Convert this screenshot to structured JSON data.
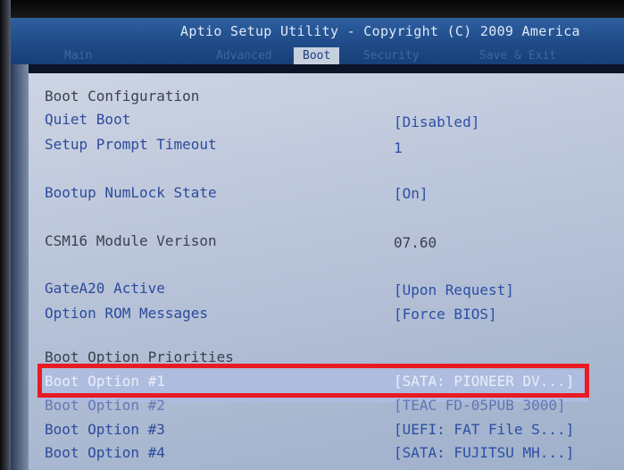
{
  "header": {
    "title": "Aptio Setup Utility - Copyright (C) 2009 America",
    "tabs": {
      "main": "Main",
      "advanced": "Advanced",
      "boot": "Boot",
      "security": "Security",
      "save_exit": "Save & Exit"
    }
  },
  "boot": {
    "section_title": "Boot Configuration",
    "quiet_boot": {
      "label": "Quiet Boot",
      "value": "[Disabled]"
    },
    "setup_prompt_timeout": {
      "label": "Setup Prompt Timeout",
      "value": "1"
    },
    "numlock": {
      "label": "Bootup NumLock State",
      "value": "[On]"
    },
    "csm16": {
      "label": "CSM16 Module Verison",
      "value": "07.60"
    },
    "gatea20": {
      "label": "GateA20 Active",
      "value": "[Upon Request]"
    },
    "option_rom": {
      "label": "Option ROM Messages",
      "value": "[Force BIOS]"
    },
    "priorities_title": "Boot Option Priorities",
    "options": [
      {
        "label": "Boot Option #1",
        "value": "[SATA: PIONEER DV...]"
      },
      {
        "label": "Boot Option #2",
        "value": "[TEAC FD-05PUB 3000]"
      },
      {
        "label": "Boot Option #3",
        "value": "[UEFI: FAT File S...]"
      },
      {
        "label": "Boot Option #4",
        "value": "[SATA: FUJITSU MH...]"
      }
    ]
  },
  "colors": {
    "header": "#1e4a86",
    "panel": "#c3cbe0",
    "highlight": "#aebce0",
    "selection_box": "#e81b23"
  }
}
